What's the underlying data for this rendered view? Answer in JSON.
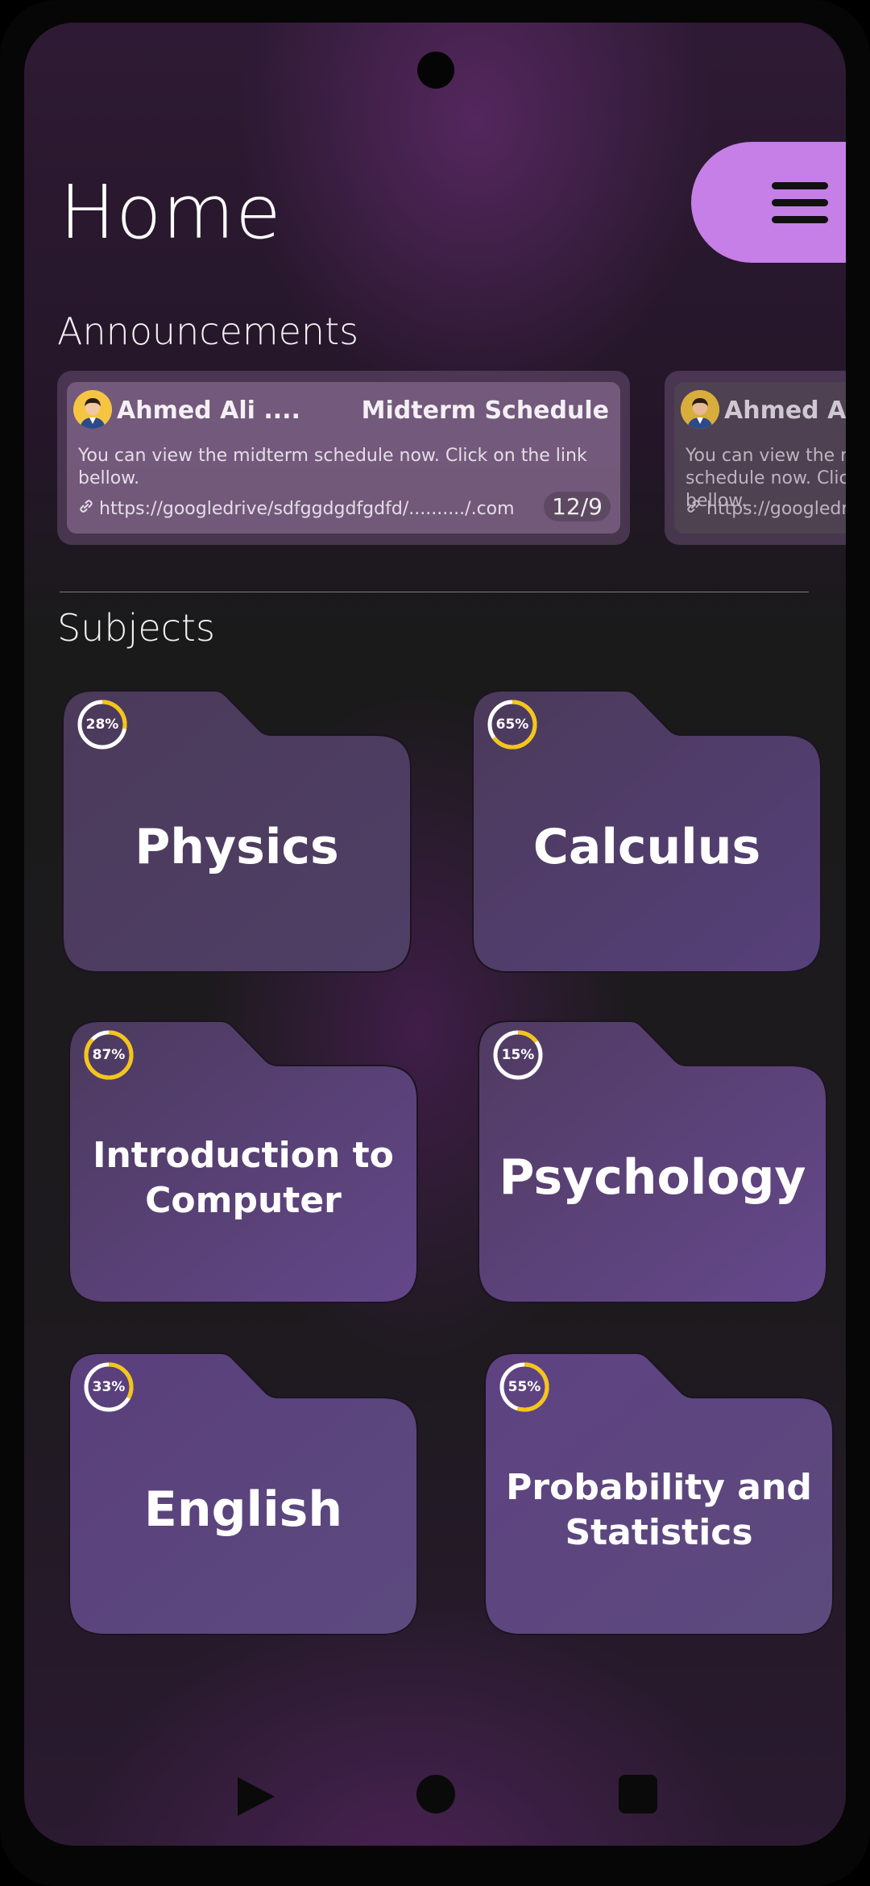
{
  "header": {
    "title": "Home",
    "menu_icon": "hamburger-menu-icon",
    "accent_color": "#c57fe6"
  },
  "announcements": {
    "section_label": "Announcements",
    "items": [
      {
        "author": "Ahmed Ali ....",
        "subject": "Midterm Schedule",
        "body": "You can view the midterm schedule now. Click on the link bellow.",
        "link": "https://googledrive/sdfggdgdfgdfd/........../.com",
        "date": "12/9",
        "avatar_icon": "user-avatar-icon",
        "link_icon": "link-icon"
      },
      {
        "author": "Ahmed Ali",
        "subject": "",
        "body": "You can view the midterm schedule now. Click on the link bellow.",
        "link": "https://googledrive/sdfggdgdfgdfd/........../.com",
        "date": "",
        "avatar_icon": "user-avatar-icon",
        "link_icon": "link-icon"
      }
    ]
  },
  "subjects": {
    "section_label": "Subjects",
    "progress_color": "#f5c518",
    "items": [
      {
        "name": "Physics",
        "progress": 28,
        "progress_label": "28%"
      },
      {
        "name": "Calculus",
        "progress": 65,
        "progress_label": "65%"
      },
      {
        "name": "Introduction to Computer",
        "progress": 87,
        "progress_label": "87%"
      },
      {
        "name": "Psychology",
        "progress": 15,
        "progress_label": "15%"
      },
      {
        "name": "English",
        "progress": 33,
        "progress_label": "33%"
      },
      {
        "name": "Probability and Statistics",
        "progress": 55,
        "progress_label": "55%"
      }
    ]
  },
  "navigation": {
    "back_icon": "back-triangle-icon",
    "home_icon": "home-circle-icon",
    "recents_icon": "recents-square-icon"
  }
}
